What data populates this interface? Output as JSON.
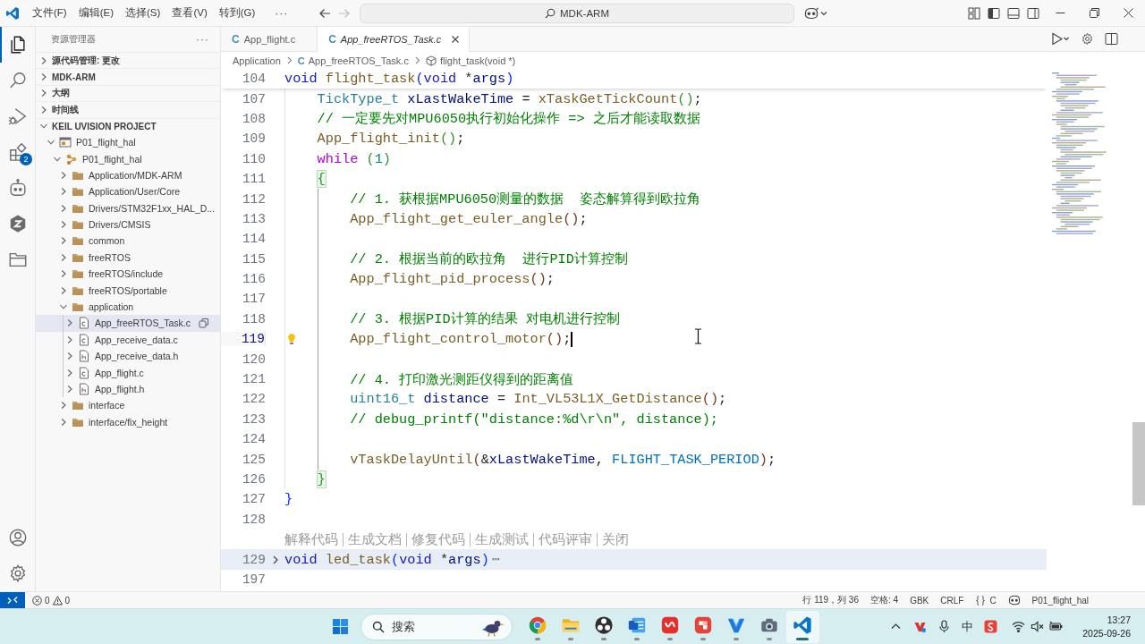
{
  "title_bar": {
    "menu": [
      "文件(F)",
      "编辑(E)",
      "选择(S)",
      "查看(V)",
      "转到(G)"
    ],
    "more": "···",
    "navigation": {
      "back_disabled": false,
      "forward_disabled": true
    },
    "command_center": "MDK-ARM"
  },
  "activity_bar": {
    "items": [
      {
        "selected": true
      },
      {
        "selected": false
      },
      {
        "selected": false
      },
      {
        "selected": false,
        "badge": "2"
      },
      {
        "selected": false
      },
      {
        "selected": false
      },
      {
        "selected": false
      }
    ]
  },
  "explorer": {
    "title": "资源管理器",
    "more": "···",
    "sections": [
      {
        "title": "源代码管理: 更改",
        "expanded": false
      },
      {
        "title": "MDK-ARM",
        "expanded": false
      },
      {
        "title": "大纲",
        "expanded": false
      },
      {
        "title": "时间线",
        "expanded": false
      },
      {
        "title": "KEIL UVISION PROJECT",
        "expanded": true,
        "tree": [
          {
            "label": "P01_flight_hal",
            "kind": "project",
            "expanded": true,
            "selected": false,
            "children": [
              {
                "label": "P01_flight_hal",
                "kind": "target",
                "expanded": true,
                "selected": false,
                "children": [
                  {
                    "label": "Application/MDK-ARM",
                    "kind": "folder",
                    "expanded": false,
                    "selected": false
                  },
                  {
                    "label": "Application/User/Core",
                    "kind": "folder",
                    "expanded": false,
                    "selected": false
                  },
                  {
                    "label": "Drivers/STM32F1xx_HAL_D...",
                    "kind": "folder",
                    "expanded": false,
                    "selected": false
                  },
                  {
                    "label": "Drivers/CMSIS",
                    "kind": "folder",
                    "expanded": false,
                    "selected": false
                  },
                  {
                    "label": "common",
                    "kind": "folder",
                    "expanded": false,
                    "selected": false
                  },
                  {
                    "label": "freeRTOS",
                    "kind": "folder",
                    "expanded": false,
                    "selected": false
                  },
                  {
                    "label": "freeRTOS/include",
                    "kind": "folder",
                    "expanded": false,
                    "selected": false
                  },
                  {
                    "label": "freeRTOS/portable",
                    "kind": "folder",
                    "expanded": false,
                    "selected": false
                  },
                  {
                    "label": "application",
                    "kind": "folder",
                    "expanded": true,
                    "selected": false,
                    "children": [
                      {
                        "label": "App_freeRTOS_Task.c",
                        "kind": "file-c",
                        "expanded": false,
                        "selected": true
                      },
                      {
                        "label": "App_receive_data.c",
                        "kind": "file-c",
                        "expanded": false,
                        "selected": false
                      },
                      {
                        "label": "App_receive_data.h",
                        "kind": "file-h",
                        "expanded": false,
                        "selected": false
                      },
                      {
                        "label": "App_flight.c",
                        "kind": "file-c",
                        "expanded": false,
                        "selected": false
                      },
                      {
                        "label": "App_flight.h",
                        "kind": "file-h",
                        "expanded": false,
                        "selected": false
                      }
                    ]
                  },
                  {
                    "label": "interface",
                    "kind": "folder",
                    "expanded": false,
                    "selected": false
                  },
                  {
                    "label": "interface/fix_height",
                    "kind": "folder",
                    "expanded": false,
                    "selected": false
                  }
                ]
              }
            ]
          }
        ]
      }
    ]
  },
  "editor": {
    "tabs": [
      {
        "icon": "C",
        "label": "App_flight.c",
        "selected": false,
        "preview": false
      },
      {
        "icon": "C",
        "label": "App_freeRTOS_Task.c",
        "selected": true,
        "preview": true
      }
    ],
    "breadcrumb": [
      {
        "kind": "folder",
        "label": "Application"
      },
      {
        "kind": "file",
        "icon": "C",
        "label": "App_freeRTOS_Task.c"
      },
      {
        "kind": "symbol",
        "label": "flight_task(void *)"
      }
    ],
    "sticky_line": {
      "number": "104",
      "tokens": [
        {
          "text": "void",
          "kind": "keyword"
        },
        {
          "text": " flight_task",
          "kind": "function"
        },
        {
          "text": "(",
          "kind": "bracket1"
        },
        {
          "text": "void",
          "kind": "keyword"
        },
        {
          "text": " *",
          "kind": "plain"
        },
        {
          "text": "args",
          "kind": "variable"
        },
        {
          "text": ")",
          "kind": "bracket1"
        }
      ]
    },
    "rows": [
      {
        "kind": "code",
        "number": "107",
        "active": false,
        "folded": false,
        "tokens": [
          {
            "text": "    TickType_t",
            "kind": "type"
          },
          {
            "text": " xLastWakeTime",
            "kind": "variable"
          },
          {
            "text": " = ",
            "kind": "plain"
          },
          {
            "text": "xTaskGetTickCount",
            "kind": "function"
          },
          {
            "text": "()",
            "kind": "bracket2"
          },
          {
            "text": ";",
            "kind": "plain"
          }
        ]
      },
      {
        "kind": "code",
        "number": "108",
        "active": false,
        "folded": false,
        "tokens": [
          {
            "text": "    // 一定要先对MPU6050执行初始化操作 => 之后才能读取数据",
            "kind": "comment"
          }
        ]
      },
      {
        "kind": "code",
        "number": "109",
        "active": false,
        "folded": false,
        "tokens": [
          {
            "text": "    App_flight_init",
            "kind": "function"
          },
          {
            "text": "()",
            "kind": "bracket2"
          },
          {
            "text": ";",
            "kind": "plain"
          }
        ]
      },
      {
        "kind": "code",
        "number": "110",
        "active": false,
        "folded": false,
        "tokens": [
          {
            "text": "    while ",
            "kind": "control"
          },
          {
            "text": "(",
            "kind": "bracket2"
          },
          {
            "text": "1",
            "kind": "number"
          },
          {
            "text": ")",
            "kind": "bracket2"
          }
        ]
      },
      {
        "kind": "code",
        "number": "111",
        "active": false,
        "folded": false,
        "tokens": [
          {
            "text": "    {",
            "kind": "bracket-match"
          }
        ]
      },
      {
        "kind": "code",
        "number": "112",
        "active": false,
        "folded": false,
        "tokens": [
          {
            "text": "        // 1. 获根据MPU6050测量的数据  姿态解算得到欧拉角",
            "kind": "comment"
          }
        ]
      },
      {
        "kind": "code",
        "number": "113",
        "active": false,
        "folded": false,
        "tokens": [
          {
            "text": "        App_flight_get_euler_angle",
            "kind": "function"
          },
          {
            "text": "()",
            "kind": "bracket3"
          },
          {
            "text": ";",
            "kind": "plain"
          }
        ]
      },
      {
        "kind": "code",
        "number": "114",
        "active": false,
        "folded": false
      },
      {
        "kind": "code",
        "number": "115",
        "active": false,
        "folded": false,
        "tokens": [
          {
            "text": "        // 2. 根据当前的欧拉角  进行PID计算控制",
            "kind": "comment"
          }
        ]
      },
      {
        "kind": "code",
        "number": "116",
        "active": false,
        "folded": false,
        "tokens": [
          {
            "text": "        App_flight_pid_process",
            "kind": "function"
          },
          {
            "text": "()",
            "kind": "bracket3"
          },
          {
            "text": ";",
            "kind": "plain"
          }
        ]
      },
      {
        "kind": "code",
        "number": "117",
        "active": false,
        "folded": false
      },
      {
        "kind": "code",
        "number": "118",
        "active": false,
        "folded": false,
        "tokens": [
          {
            "text": "        // 3. 根据PID计算的结果 对电机进行控制",
            "kind": "comment"
          }
        ]
      },
      {
        "kind": "code",
        "number": "119",
        "active": true,
        "folded": false,
        "tokens": [
          {
            "text": "        App_flight_control_motor",
            "kind": "function"
          },
          {
            "text": "()",
            "kind": "bracket3"
          },
          {
            "text": ";",
            "kind": "plain"
          }
        ]
      },
      {
        "kind": "code",
        "number": "120",
        "active": false,
        "folded": false
      },
      {
        "kind": "code",
        "number": "121",
        "active": false,
        "folded": false,
        "tokens": [
          {
            "text": "        // 4. 打印激光测距仪得到的距离值",
            "kind": "comment"
          }
        ]
      },
      {
        "kind": "code",
        "number": "122",
        "active": false,
        "folded": false,
        "tokens": [
          {
            "text": "        uint16_t",
            "kind": "type"
          },
          {
            "text": " distance",
            "kind": "variable"
          },
          {
            "text": " = ",
            "kind": "plain"
          },
          {
            "text": "Int_VL53L1X_GetDistance",
            "kind": "function"
          },
          {
            "text": "()",
            "kind": "bracket3"
          },
          {
            "text": ";",
            "kind": "plain"
          }
        ]
      },
      {
        "kind": "code",
        "number": "123",
        "active": false,
        "folded": false,
        "tokens": [
          {
            "text": "        // debug_printf(\"distance:%d\\r\\n\", distance);",
            "kind": "comment"
          }
        ]
      },
      {
        "kind": "code",
        "number": "124",
        "active": false,
        "folded": false
      },
      {
        "kind": "code",
        "number": "125",
        "active": false,
        "folded": false,
        "tokens": [
          {
            "text": "        vTaskDelayUntil",
            "kind": "function"
          },
          {
            "text": "(",
            "kind": "bracket3"
          },
          {
            "text": "&",
            "kind": "plain"
          },
          {
            "text": "xLastWakeTime",
            "kind": "variable"
          },
          {
            "text": ", ",
            "kind": "plain"
          },
          {
            "text": "FLIGHT_TASK_PERIOD",
            "kind": "macro"
          },
          {
            "text": ")",
            "kind": "bracket3"
          },
          {
            "text": ";",
            "kind": "plain"
          }
        ]
      },
      {
        "kind": "code",
        "number": "126",
        "active": false,
        "folded": false,
        "tokens": [
          {
            "text": "    }",
            "kind": "bracket-match"
          }
        ]
      },
      {
        "kind": "code",
        "number": "127",
        "active": false,
        "folded": false,
        "tokens": [
          {
            "text": "}",
            "kind": "bracket1"
          }
        ]
      },
      {
        "kind": "code",
        "number": "128",
        "active": false,
        "folded": false
      },
      {
        "kind": "lens",
        "actions": [
          "解释代码",
          "生成文档",
          "修复代码",
          "生成测试",
          "代码评审",
          "关闭"
        ]
      },
      {
        "kind": "code",
        "number": "129",
        "active": false,
        "folded": true,
        "ellipsis": "⋯",
        "tokens": [
          {
            "text": "void",
            "kind": "keyword"
          },
          {
            "text": " led_task",
            "kind": "function"
          },
          {
            "text": "(",
            "kind": "bracket1"
          },
          {
            "text": "void",
            "kind": "keyword"
          },
          {
            "text": " *",
            "kind": "plain"
          },
          {
            "text": "args",
            "kind": "variable"
          },
          {
            "text": ")",
            "kind": "bracket1"
          }
        ]
      },
      {
        "kind": "code",
        "number": "197",
        "active": false,
        "folded": false
      }
    ]
  },
  "status_bar": {
    "errors": "0",
    "warnings": "0",
    "cursor": "行 119，列 36",
    "indentation": "空格: 4",
    "encoding": "GBK",
    "line_ending": "CRLF",
    "language": "C",
    "project": "P01_flight_hal"
  },
  "taskbar": {
    "search": {
      "placeholder": "搜索"
    },
    "apps": [
      {
        "running": true,
        "selected": false
      },
      {
        "running": true,
        "selected": false
      },
      {
        "running": true,
        "selected": false
      },
      {
        "running": true,
        "selected": false
      },
      {
        "running": true,
        "selected": false
      },
      {
        "running": true,
        "selected": false
      },
      {
        "running": true,
        "selected": false
      },
      {
        "running": true,
        "selected": false
      },
      {
        "running": true,
        "selected": true
      }
    ],
    "input_mode": "中",
    "clock": {
      "time": "13:27",
      "date": "2025-09-26"
    }
  }
}
